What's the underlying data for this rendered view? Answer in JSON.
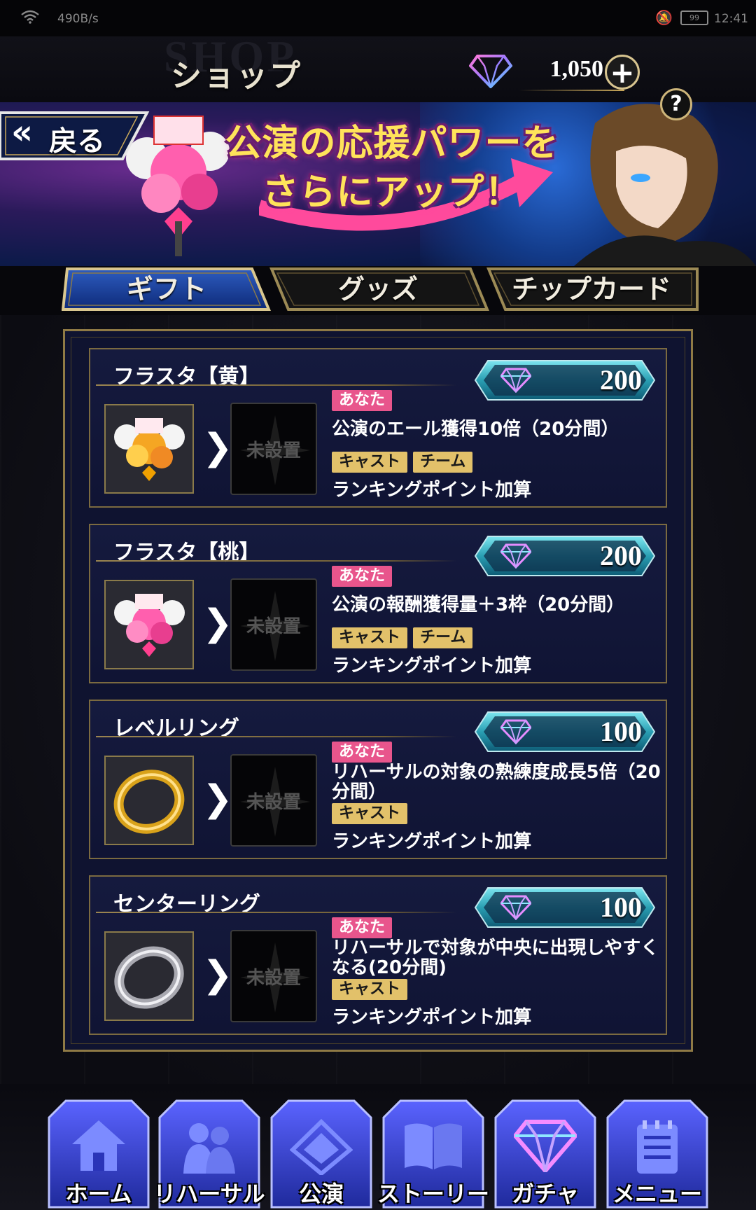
{
  "status_bar": {
    "speed": "490B/s",
    "battery": "99",
    "time": "12:41"
  },
  "header": {
    "title_bg": "SHOP",
    "title": "ショップ",
    "currency_amount": "1,050",
    "plus_label": "+"
  },
  "banner": {
    "back_label": "戻る",
    "headline_line1": "公演の応援パワーを",
    "headline_line2": "さらにアップ！",
    "help_label": "?"
  },
  "tabs": [
    {
      "label": "ギフト",
      "active": true
    },
    {
      "label": "グッズ",
      "active": false
    },
    {
      "label": "チップカード",
      "active": false
    }
  ],
  "items": [
    {
      "name": "フラスタ【黄】",
      "price": "200",
      "slot_label": "未設置",
      "you_tag": "あなた",
      "effect": "公演のエール獲得10倍（20分間）",
      "tags": [
        "キャスト",
        "チーム"
      ],
      "bonus": "ランキングポイント加算",
      "thumb_icon": "yellow-flower-stand-icon"
    },
    {
      "name": "フラスタ【桃】",
      "price": "200",
      "slot_label": "未設置",
      "you_tag": "あなた",
      "effect": "公演の報酬獲得量＋3枠（20分間）",
      "tags": [
        "キャスト",
        "チーム"
      ],
      "bonus": "ランキングポイント加算",
      "thumb_icon": "pink-flower-stand-icon"
    },
    {
      "name": "レベルリング",
      "price": "100",
      "slot_label": "未設置",
      "you_tag": "あなた",
      "effect": "リハーサルの対象の熟練度成長5倍（20分間）",
      "tags": [
        "キャスト"
      ],
      "bonus": "ランキングポイント加算",
      "thumb_icon": "gold-ring-icon"
    },
    {
      "name": "センターリング",
      "price": "100",
      "slot_label": "未設置",
      "you_tag": "あなた",
      "effect": "リハーサルで対象が中央に出現しやすくなる(20分間)",
      "tags": [
        "キャスト"
      ],
      "bonus": "ランキングポイント加算",
      "thumb_icon": "silver-ring-icon"
    }
  ],
  "nav": [
    {
      "label": "ホーム",
      "icon": "home-icon"
    },
    {
      "label": "リハーサル",
      "icon": "rehearsal-icon"
    },
    {
      "label": "公演",
      "icon": "stage-icon"
    },
    {
      "label": "ストーリー",
      "icon": "book-icon"
    },
    {
      "label": "ガチャ",
      "icon": "gem-icon"
    },
    {
      "label": "メニュー",
      "icon": "menu-icon"
    }
  ],
  "colors": {
    "gold": "#c9a85a",
    "price_cyan": "#2fb8c8",
    "tag_you": "#e8558c",
    "tag_gold": "#e2c16a",
    "panel_navy": "#0f1330",
    "nav_blue": "#3b40c8"
  }
}
